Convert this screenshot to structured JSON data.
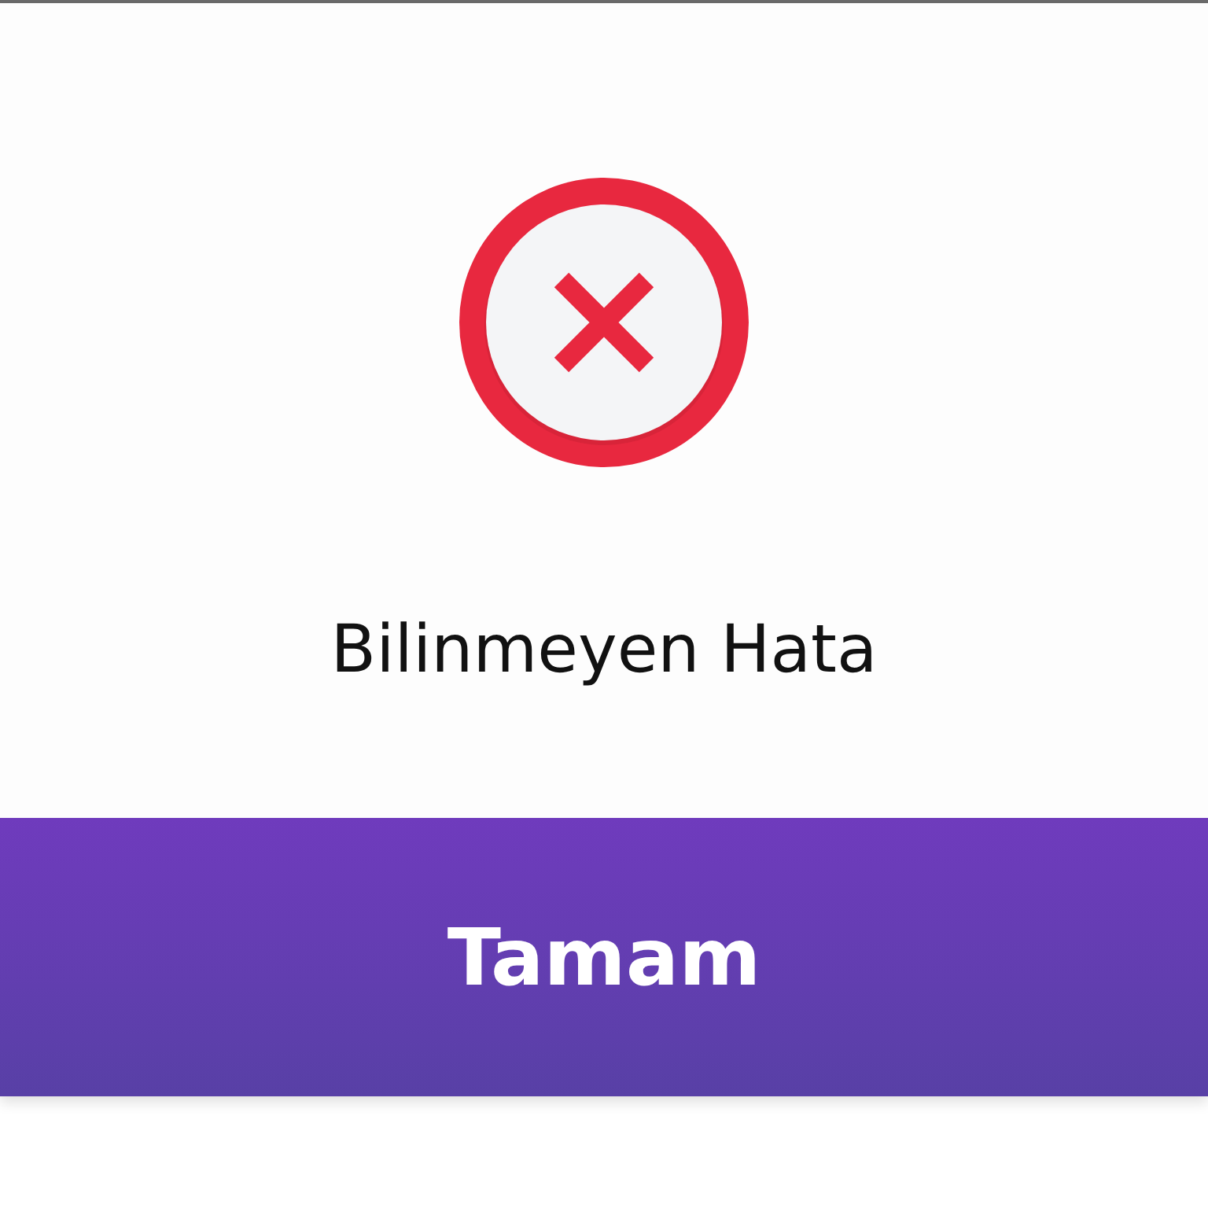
{
  "dialog": {
    "message": "Bilinmeyen Hata",
    "error": true,
    "button": "Tamam"
  }
}
